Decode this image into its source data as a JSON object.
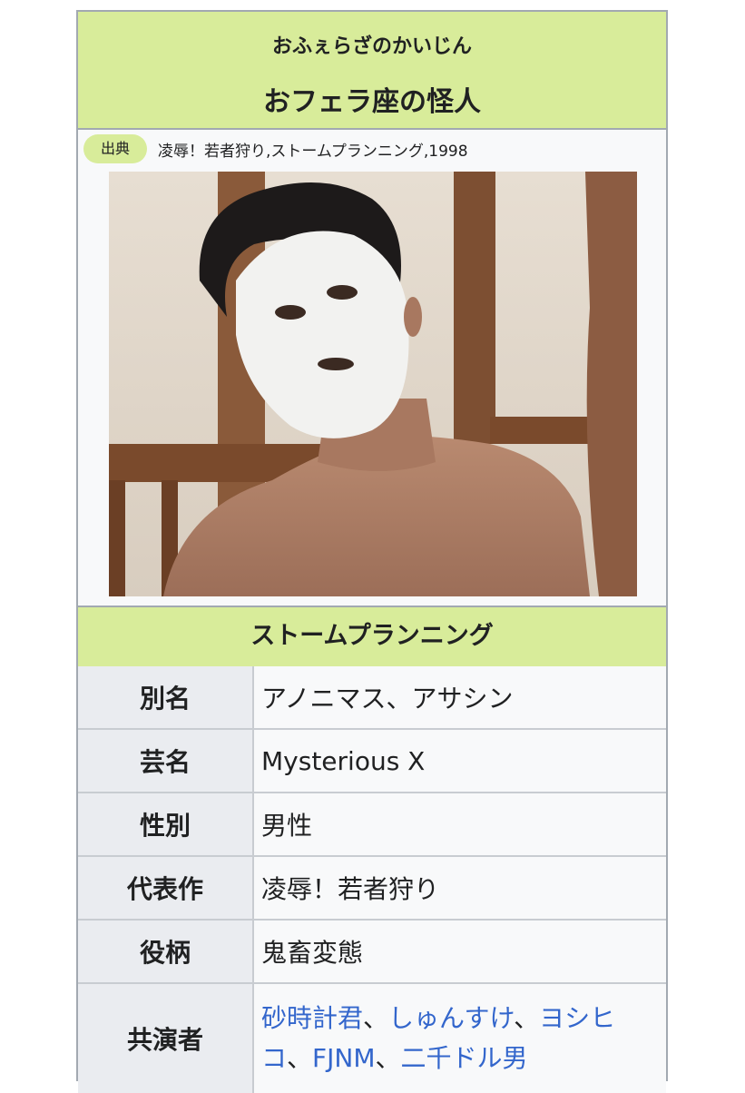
{
  "header": {
    "reading": "おふぇらざのかいじん",
    "title": "おフェラ座の怪人"
  },
  "source": {
    "label": "出典",
    "text": "凌辱！若者狩り,ストームプランニング,1998"
  },
  "image": {
    "description": "white-mask-man-photo"
  },
  "section": {
    "title": "ストームプランニング"
  },
  "attributes": [
    {
      "label": "別名",
      "value": "アノニマス、アサシン"
    },
    {
      "label": "芸名",
      "value": "Mysterious X"
    },
    {
      "label": "性別",
      "value": "男性"
    },
    {
      "label": "代表作",
      "value": "凌辱！若者狩り"
    },
    {
      "label": "役柄",
      "value": "鬼畜変態"
    }
  ],
  "costars": {
    "label": "共演者",
    "separator": "、",
    "items": [
      "砂時計君",
      "しゅんすけ",
      "ヨシヒコ",
      "FJNM",
      "二千ドル男"
    ]
  },
  "colors": {
    "header_bg": "#d8ec9a",
    "label_bg": "#eaecf0",
    "value_bg": "#f8f9fa",
    "border": "#a2a9b1",
    "link": "#3366cc"
  }
}
